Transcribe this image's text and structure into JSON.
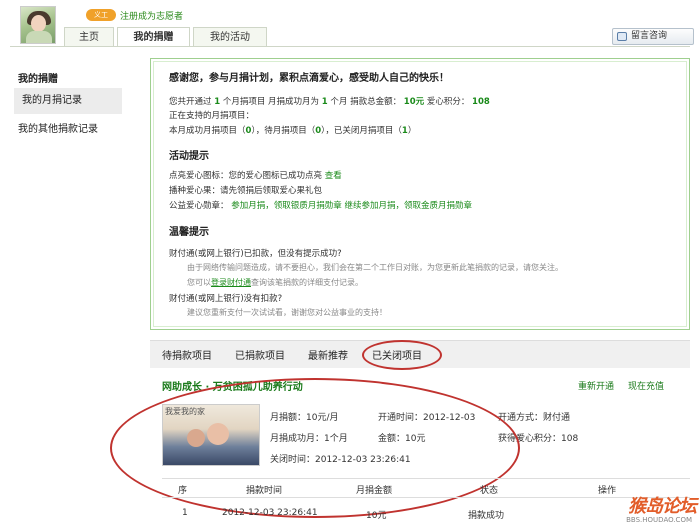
{
  "header": {
    "volunteer_badge": "义工",
    "volunteer_link": "注册成为志愿者",
    "tabs": [
      "主页",
      "我的捐赠",
      "我的活动"
    ],
    "message_button": "留言咨询"
  },
  "sidebar": {
    "title": "我的捐赠",
    "items": [
      "我的月捐记录",
      "我的其他捐款记录"
    ]
  },
  "info": {
    "headline": "感谢您，参与月捐计划，累积点滴爱心，感受助人自己的快乐！",
    "summary": {
      "p1": "您共开通过",
      "count": "1",
      "p2": "个月捐项目  月捐成功月为",
      "months": "1",
      "p3": "个月  捐款总金额：",
      "amount": "10元",
      "p4": "爱心积分：",
      "points": "108"
    },
    "supporting": "正在支持的月捐项目：",
    "status_line": {
      "a": "本月成功月捐项目（",
      "a_val": "0",
      "b": "），待月捐项目（",
      "b_val": "0",
      "c": "），已关闭月捐项目（",
      "c_val": "1",
      "d": "）"
    },
    "activity_title": "活动提示",
    "activity": {
      "row1_label": "点亮爱心图标：您的爱心图标已成功点亮",
      "row1_link": "查看",
      "row2": "播种爱心果：请先领捐后领取爱心果礼包",
      "row3_label": "公益爱心勋章：",
      "row3_link1": "参加月捐，领取银质月捐勋章",
      "row3_link2": "继续参加月捐，领取金质月捐勋章"
    },
    "tips_title": "温馨提示",
    "tips": {
      "q1": "财付通(或网上银行)已扣款，但没有提示成功?",
      "a1": "由于网络传输问题造成，请不要担心，我们会在第二个工作日对账，为您更新此笔捐款的记录，请您关注。",
      "a1b_pre": "您可以",
      "a1b_link": "登录财付通",
      "a1b_post": "查询该笔捐款的详细支付记录。",
      "q2": "财付通(或网上银行)没有扣款?",
      "a2": "建议您重新支付一次试试看，谢谢您对公益事业的支持！"
    }
  },
  "bottom_tabs": [
    "待捐款项目",
    "已捐款项目",
    "最新推荐",
    "已关闭项目"
  ],
  "project": {
    "title": "网助成长 · 万贫困孤儿助养行动",
    "reopen": "重新开通",
    "recharge": "现在充值",
    "image_caption": "我爱我的家",
    "monthly_amount": "月捐额：10元/月",
    "open_time": "开通时间：2012-12-03",
    "open_method": "开通方式：财付通",
    "success_months": "月捐成功月：1个月",
    "total_amount": "金额：10元",
    "points": "获得爱心积分：108",
    "close_time": "关闭时间：2012-12-03 23:26:41"
  },
  "table": {
    "headers": [
      "序",
      "捐款时间",
      "月捐金额",
      "状态",
      "操作"
    ],
    "rows": [
      [
        "1",
        "2012-12-03 23:26:41",
        "10元",
        "捐款成功",
        ""
      ]
    ]
  },
  "watermark": {
    "main": "猴岛论坛",
    "sub": "BBS.HOUDAO.COM"
  }
}
